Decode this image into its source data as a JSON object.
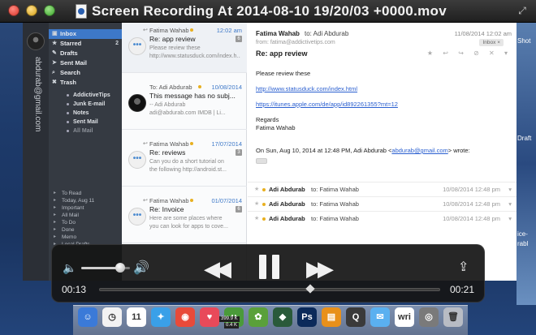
{
  "window": {
    "title": "Screen Recording At 2014-08-10 19/20/03 +0000.mov"
  },
  "account": {
    "email": "abdurab@gmail.com"
  },
  "folders": [
    {
      "label": "Inbox",
      "icon": "inbox-icon",
      "glyph": "▣",
      "count": ""
    },
    {
      "label": "Starred",
      "icon": "star-icon",
      "glyph": "★",
      "count": "2"
    },
    {
      "label": "Drafts",
      "icon": "pencil-icon",
      "glyph": "✎",
      "count": ""
    },
    {
      "label": "Sent Mail",
      "icon": "send-icon",
      "glyph": "➤",
      "count": ""
    },
    {
      "label": "Search",
      "icon": "search-icon",
      "glyph": "⌕",
      "count": ""
    },
    {
      "label": "Trash",
      "icon": "trash-icon",
      "glyph": "✖",
      "count": ""
    }
  ],
  "subfolders": [
    {
      "label": "AddictiveTips"
    },
    {
      "label": "Junk E-mail"
    },
    {
      "label": "Notes"
    },
    {
      "label": "Sent Mail"
    },
    {
      "label": "All Mail"
    }
  ],
  "smart_folders": [
    {
      "label": "To Read"
    },
    {
      "label": "Today, Aug 11"
    },
    {
      "label": "Important"
    },
    {
      "label": "All Mail"
    },
    {
      "label": "To Do"
    },
    {
      "label": "Done"
    },
    {
      "label": "Memo"
    },
    {
      "label": "Local Drafts"
    }
  ],
  "messages": [
    {
      "from": "Fatima Wahab",
      "date": "12:02 am",
      "subject": "Re: app review",
      "preview1": "Please review these",
      "preview2": "http://www.statusduck.com/index.h...",
      "badge": "6",
      "avatar": "•••"
    },
    {
      "from": "To: Adi Abdurab",
      "date": "10/08/2014",
      "subject": "This message has no subj...",
      "preview1": "-- Adi Abdurab",
      "preview2": "adi@abdurab.com IMDB | Li...",
      "badge": "",
      "avatar": ""
    },
    {
      "from": "Fatima Wahab",
      "date": "17/07/2014",
      "subject": "Re: reviews",
      "preview1": "Can you do a short tutorial on",
      "preview2": "the following http://android.st...",
      "badge": "3",
      "avatar": "•••"
    },
    {
      "from": "Fatima Wahab",
      "date": "01/07/2014",
      "subject": "Re: Invoice",
      "preview1": "Here are some places where",
      "preview2": "you can look for apps to cove...",
      "badge": "6",
      "avatar": "•••"
    }
  ],
  "reader": {
    "from": "Fatima Wahab",
    "to": "to: Adi Abdurab",
    "date": "11/08/2014 12:02 am",
    "sender_address": "from: fatima@addictivetips.com",
    "tag": "Inbox ×",
    "subject": "Re: app review",
    "body_intro": "Please review these",
    "link1": "http://www.statusduck.com/index.html",
    "link2": "https://itunes.apple.com/de/app/id892261355?mt=12",
    "regards": "Regards",
    "signature": "Fatima Wahab",
    "quote_prefix": "On Sun, Aug 10, 2014 at 12:48 PM, Adi Abdurab <",
    "quote_email": "abdurab@gmail.com",
    "quote_suffix": "> wrote:",
    "actions": "★ ↩ ↪ ⊘ ✕ ▾"
  },
  "thread": [
    {
      "from": "Adi Abdurab",
      "to": "to: Fatima Wahab",
      "date": "10/08/2014 12:48 pm"
    },
    {
      "from": "Adi Abdurab",
      "to": "to: Fatima Wahab",
      "date": "10/08/2014 12:48 pm"
    },
    {
      "from": "Adi Abdurab",
      "to": "to: Fatima Wahab",
      "date": "10/08/2014 12:48 pm"
    }
  ],
  "desktop_labels": {
    "shot": "Shot",
    "draft": "Draft",
    "ice": "ice-",
    "rabl": "rabl"
  },
  "player": {
    "elapsed": "00:13",
    "remaining": "00:21",
    "progress": 0.62,
    "volume": 0.8
  },
  "dock": [
    {
      "name": "finder-icon",
      "bg": "#3b7ad8",
      "glyph": "☺"
    },
    {
      "name": "clock-icon",
      "bg": "#f2f2f2",
      "glyph": "◷"
    },
    {
      "name": "calendar-icon",
      "bg": "#ffffff",
      "glyph": "11"
    },
    {
      "name": "safari-icon",
      "bg": "#3aa0e8",
      "glyph": "✦"
    },
    {
      "name": "chrome-icon",
      "bg": "#e84a3a",
      "glyph": "◉"
    },
    {
      "name": "pocket-icon",
      "bg": "#e84a5a",
      "glyph": "♥"
    },
    {
      "name": "utorrent-icon",
      "bg": "#4a9a3a",
      "glyph": "μ"
    },
    {
      "name": "evernote-icon",
      "bg": "#5aa03a",
      "glyph": "✿"
    },
    {
      "name": "app-icon",
      "bg": "#2a5a3a",
      "glyph": "◆"
    },
    {
      "name": "photoshop-icon",
      "bg": "#0b2a5a",
      "glyph": "Ps"
    },
    {
      "name": "ibooks-icon",
      "bg": "#e8901a",
      "glyph": "▤"
    },
    {
      "name": "quicktime-icon",
      "bg": "#3a3a3a",
      "glyph": "Q"
    },
    {
      "name": "messages-icon",
      "bg": "#5ab0f0",
      "glyph": "✉"
    },
    {
      "name": "textwrangler-icon",
      "bg": "#ffffff",
      "glyph": "wri"
    },
    {
      "name": "disk-icon",
      "bg": "#7a7a7a",
      "glyph": "◎"
    },
    {
      "name": "trash-dock-icon",
      "bg": "#b8bcc4",
      "glyph": "🗑"
    }
  ],
  "dock_badge": {
    "up": "399.9 K",
    "down": "0.4 K"
  },
  "colors": {
    "accent": "#3d78c8",
    "link": "#2a5fd0",
    "sidebar": "#353a42"
  }
}
